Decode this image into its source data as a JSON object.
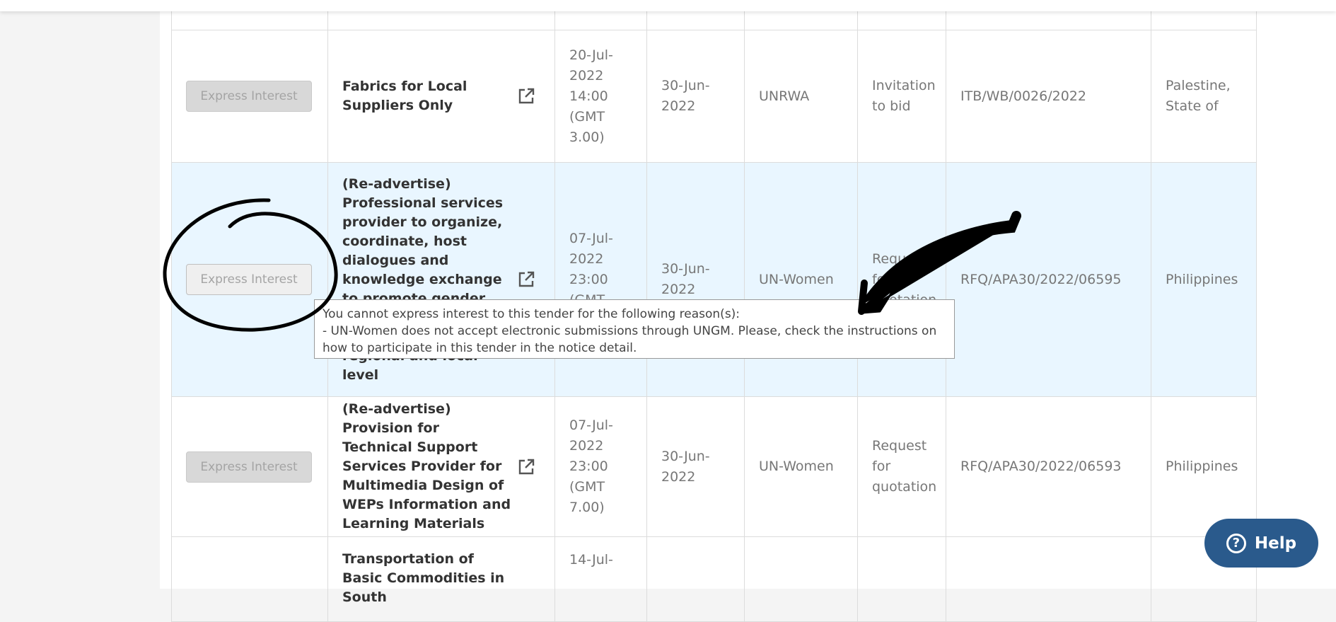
{
  "help": {
    "label": "Help",
    "icon": "question-circle-icon"
  },
  "tooltip": {
    "line1": "You cannot express interest to this tender for the following reason(s):",
    "line2": "- UN-Women does not accept electronic submissions through UNGM. Please, check the instructions on how to participate in this tender in the notice detail."
  },
  "table": {
    "rows": [
      {
        "button": "Express Interest",
        "title": "",
        "deadline": "",
        "published": "",
        "agency": "",
        "type": "",
        "reference": "",
        "country": ""
      },
      {
        "button": "Express Interest",
        "title": "Fabrics for Local Suppliers Only",
        "deadline": "20-Jul-2022 14:00 (GMT 3.00)",
        "published": "30-Jun-2022",
        "agency": "UNRWA",
        "type": "Invitation to bid",
        "reference": "ITB/WB/0026/2022",
        "country": "Palestine, State of"
      },
      {
        "button": "Express Interest",
        "title": "(Re-advertise) Professional services provider to organize, coordinate, host dialogues and knowledge exchange to promote gender responsive procurement at the regional and local level",
        "deadline": "07-Jul-2022 23:00 (GMT 7.00)",
        "published": "30-Jun-2022",
        "agency": "UN-Women",
        "type": "Request for quotation",
        "reference": "RFQ/APA30/2022/06595",
        "country": "Philippines"
      },
      {
        "button": "Express Interest",
        "title": "(Re-advertise) Provision for Technical Support Services Provider for Multimedia Design of WEPs Information and Learning Materials",
        "deadline": "07-Jul-2022 23:00 (GMT 7.00)",
        "published": "30-Jun-2022",
        "agency": "UN-Women",
        "type": "Request for quotation",
        "reference": "RFQ/APA30/2022/06593",
        "country": "Philippines"
      },
      {
        "button": "",
        "title": "Transportation of Basic Commodities in South",
        "deadline": "14-Jul-",
        "published": "",
        "agency": "",
        "type": "",
        "reference": "",
        "country": ""
      }
    ]
  },
  "colors": {
    "highlight": "#e9f6ff",
    "help": "#2a5a8c",
    "button": "#d8d8d8"
  }
}
